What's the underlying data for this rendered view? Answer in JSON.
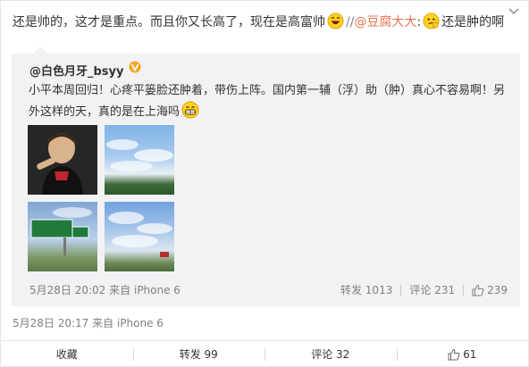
{
  "post": {
    "text_1": "还是帅的，这才是重点。而且你又长高了，现在是高富帅",
    "separator": "//",
    "mention": "@豆腐大大",
    "mention_colon": ":",
    "text_2": "还是肿的啊",
    "timestamp": "5月28日 20:17",
    "source_prefix": "来自",
    "source": "iPhone 6"
  },
  "repost": {
    "user": "@白色月牙_bsyy",
    "text": "小平本周回归！心疼平篓脸还肿着，带伤上阵。国内第一辅（浮）助（肿）真心不容易啊！另外这样的天，真的是在上海吗",
    "timestamp": "5月28日 20:02",
    "source_prefix": "来自",
    "source": "iPhone 6",
    "repost_label": "转发",
    "repost_count": "1013",
    "comment_label": "评论",
    "comment_count": "231",
    "like_count": "239"
  },
  "actions": {
    "favorite": "收藏",
    "repost": "转发 99",
    "comment": "评论 32",
    "like": "61"
  },
  "colors": {
    "mention": "#eb7350",
    "secondary_text": "#808080",
    "repost_bg": "#f2f2f5"
  },
  "icons": [
    "chevron-down-icon",
    "laugh-emoji-icon",
    "thinking-emoji-icon",
    "verified-badge-icon",
    "grin-emoji-icon",
    "thumbs-up-icon"
  ]
}
